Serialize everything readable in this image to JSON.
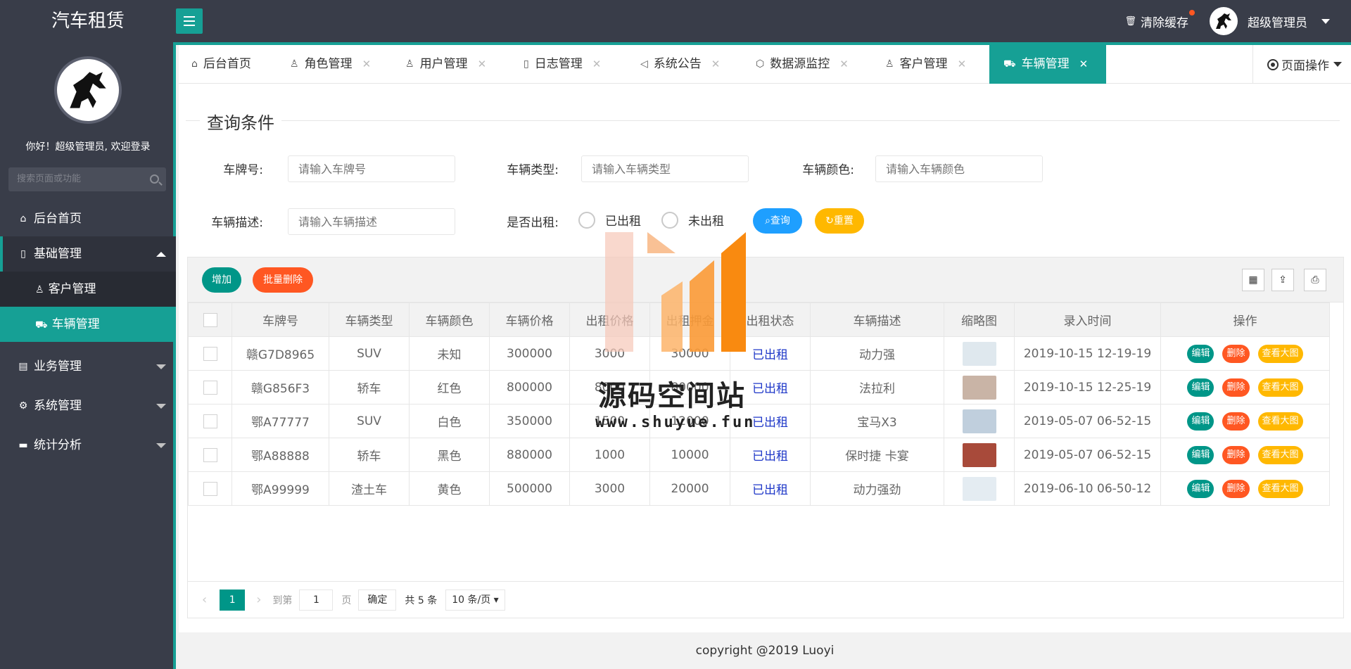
{
  "app": {
    "title": "汽车租赁"
  },
  "header": {
    "clear_cache": "清除缓存",
    "admin_name": "超级管理员"
  },
  "sidebar": {
    "welcome": "你好！超级管理员, 欢迎登录",
    "search_placeholder": "搜索页面或功能",
    "items": [
      {
        "label": "后台首页",
        "icon": "home-icon"
      },
      {
        "label": "基础管理",
        "icon": "file-icon"
      },
      {
        "label": "客户管理",
        "icon": "user-icon"
      },
      {
        "label": "车辆管理",
        "icon": "cart-icon"
      },
      {
        "label": "业务管理",
        "icon": "table-icon"
      },
      {
        "label": "系统管理",
        "icon": "gear-icon"
      },
      {
        "label": "统计分析",
        "icon": "monitor-icon"
      }
    ]
  },
  "tabs": [
    {
      "label": "后台首页",
      "icon": "home-icon"
    },
    {
      "label": "角色管理",
      "icon": "user-icon"
    },
    {
      "label": "用户管理",
      "icon": "users-icon"
    },
    {
      "label": "日志管理",
      "icon": "note-icon"
    },
    {
      "label": "系统公告",
      "icon": "speaker-icon"
    },
    {
      "label": "数据源监控",
      "icon": "cube-icon"
    },
    {
      "label": "客户管理",
      "icon": "users-icon"
    },
    {
      "label": "车辆管理",
      "icon": "cart-icon"
    }
  ],
  "page_ops": "页面操作",
  "query": {
    "legend": "查询条件",
    "plate_label": "车牌号:",
    "plate_placeholder": "请输入车牌号",
    "type_label": "车辆类型:",
    "type_placeholder": "请输入车辆类型",
    "color_label": "车辆颜色:",
    "color_placeholder": "请输入车辆颜色",
    "desc_label": "车辆描述:",
    "desc_placeholder": "请输入车辆描述",
    "rented_label": "是否出租:",
    "rented_yes": "已出租",
    "rented_no": "未出租",
    "search_btn": "查询",
    "reset_btn": "重置"
  },
  "toolbar": {
    "add": "增加",
    "batch_delete": "批量删除"
  },
  "table": {
    "headers": [
      "车牌号",
      "车辆类型",
      "车辆颜色",
      "车辆价格",
      "出租价格",
      "出租押金",
      "出租状态",
      "车辆描述",
      "缩略图",
      "录入时间",
      "操作"
    ],
    "rows": [
      [
        "赣G7D8965",
        "SUV",
        "未知",
        "300000",
        "3000",
        "30000",
        "已出租",
        "动力强",
        "",
        "2019-10-15 12-19-19"
      ],
      [
        "赣G856F3",
        "轿车",
        "红色",
        "800000",
        "8000",
        "80000",
        "已出租",
        "法拉利",
        "",
        "2019-10-15 12-25-19"
      ],
      [
        "鄂A77777",
        "SUV",
        "白色",
        "350000",
        "1500",
        "12000",
        "已出租",
        "宝马X3",
        "",
        "2019-05-07 06-52-15"
      ],
      [
        "鄂A88888",
        "轿车",
        "黑色",
        "880000",
        "1000",
        "10000",
        "已出租",
        "保时捷 卡宴",
        "",
        "2019-05-07 06-52-15"
      ],
      [
        "鄂A99999",
        "渣土车",
        "黄色",
        "500000",
        "3000",
        "20000",
        "已出租",
        "动力强劲",
        "",
        "2019-06-10 06-50-12"
      ]
    ],
    "ops": {
      "edit": "编辑",
      "delete": "删除",
      "view": "查看大图"
    }
  },
  "pager": {
    "current": "1",
    "goto": "到第",
    "page_input": "1",
    "page_unit": "页",
    "confirm": "确定",
    "total": "共 5 条",
    "per_page": "10 条/页"
  },
  "footer": "copyright @2019 Luoyi",
  "watermark": {
    "text": "源码空间站",
    "url": "www.shuyue.fun"
  },
  "colors": {
    "teal": "#16a095",
    "dark": "#393d49",
    "orange": "#ff5722",
    "yellow": "#ffb800",
    "blue": "#1e9fff"
  }
}
